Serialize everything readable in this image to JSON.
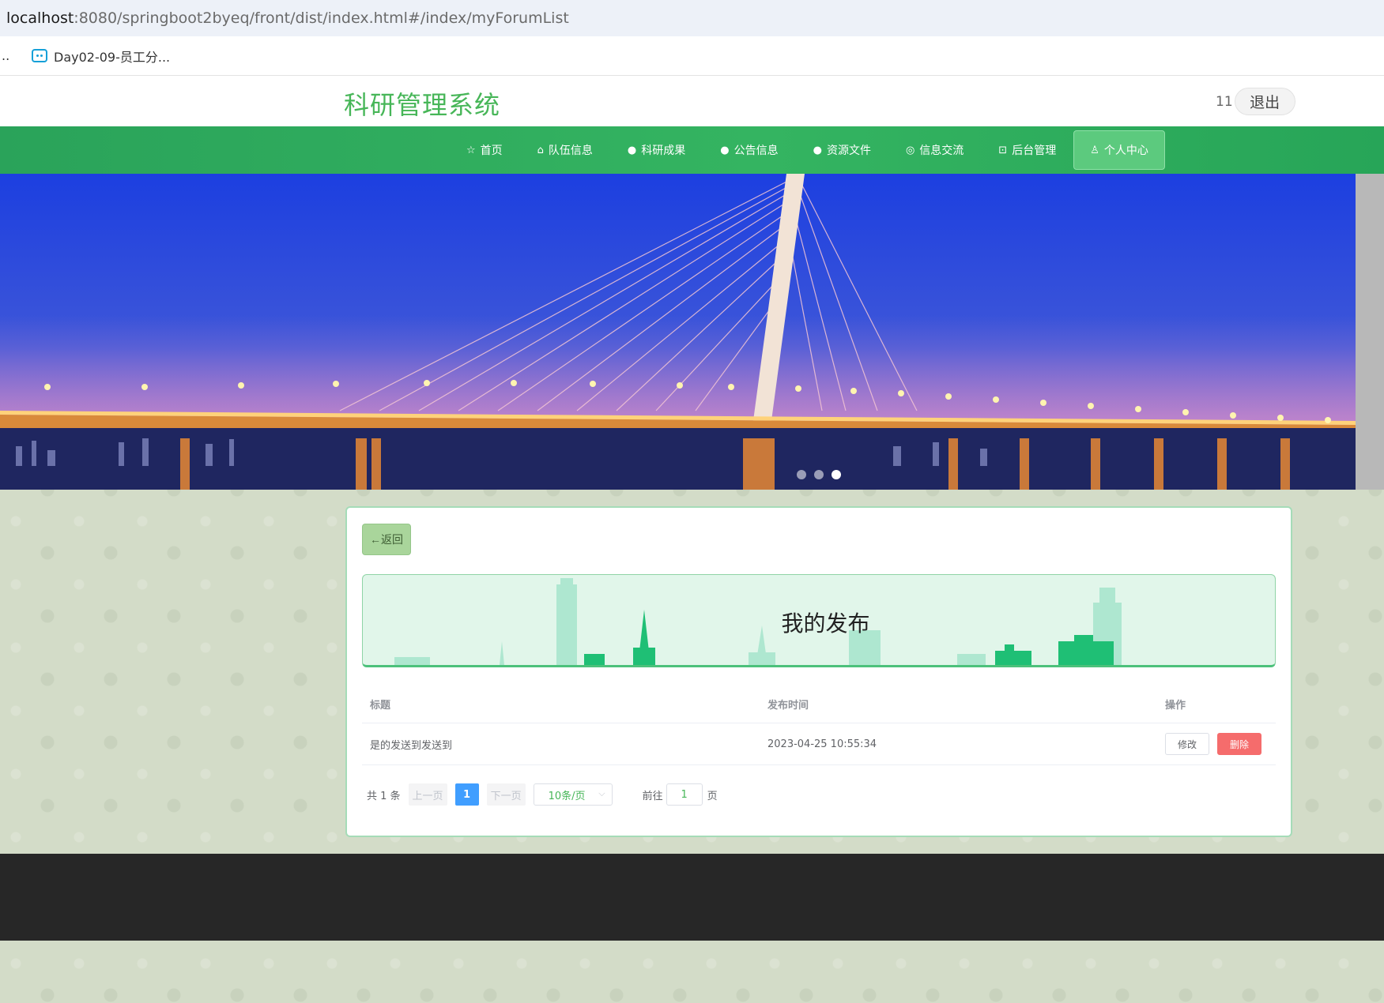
{
  "browser": {
    "url_host": "localhost",
    "url_rest": ":8080/springboot2byeq/front/dist/index.html#/index/myForumList",
    "bookmark_dots": "..",
    "bookmark_label": "Day02-09-员工分..."
  },
  "header": {
    "title": "科研管理系统",
    "username": "11",
    "logout_label": "退出"
  },
  "nav": {
    "items": [
      {
        "label": "首页",
        "icon": "☆"
      },
      {
        "label": "队伍信息",
        "icon": "⌂"
      },
      {
        "label": "科研成果",
        "icon": "●"
      },
      {
        "label": "公告信息",
        "icon": "●"
      },
      {
        "label": "资源文件",
        "icon": "●"
      },
      {
        "label": "信息交流",
        "icon": "◎"
      },
      {
        "label": "后台管理",
        "icon": "⊡"
      },
      {
        "label": "个人中心",
        "icon": "♙"
      }
    ],
    "active_index": 7
  },
  "carousel": {
    "slide_count": 3,
    "active_slide": 3
  },
  "content": {
    "back_label": "←返回",
    "title": "我的发布",
    "table": {
      "headers": [
        "标题",
        "发布时间",
        "操作"
      ],
      "rows": [
        {
          "title": "是的发送到发送到",
          "time": "2023-04-25 10:55:34"
        }
      ],
      "edit_label": "修改",
      "delete_label": "删除"
    },
    "pagination": {
      "total_text": "共 1 条",
      "prev_label": "上一页",
      "current_page": "1",
      "next_label": "下一页",
      "page_size": "10条/页",
      "goto_label": "前往",
      "goto_value": "1",
      "page_unit": "页"
    }
  },
  "colors": {
    "brand_green": "#47b658",
    "nav_green": "#34b461",
    "danger": "#f56c6c",
    "primary": "#409eff",
    "footer": "#272727"
  }
}
